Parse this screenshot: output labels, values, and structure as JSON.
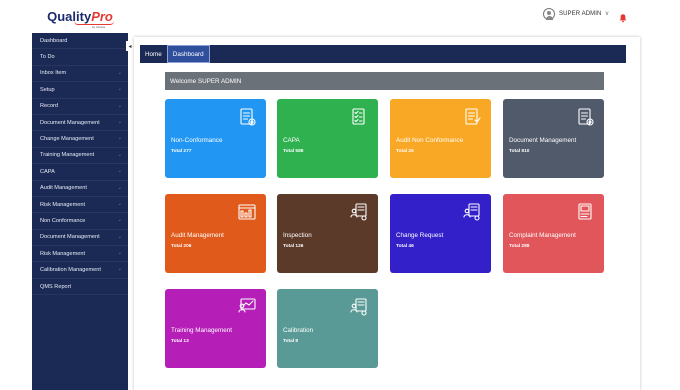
{
  "brand": {
    "name_main": "Quality",
    "name_accent": "Pro",
    "tagline": "by Vindus"
  },
  "header": {
    "user_name": "SUPER ADMIN",
    "caret": "v"
  },
  "sidebar": {
    "items": [
      {
        "label": "Dashboard",
        "chev": false
      },
      {
        "label": "To Do",
        "chev": false
      },
      {
        "label": "Inbox Item",
        "chev": true
      },
      {
        "label": "Setup",
        "chev": true
      },
      {
        "label": "Record",
        "chev": true
      },
      {
        "label": "Document Management",
        "chev": true
      },
      {
        "label": "Change Management",
        "chev": true
      },
      {
        "label": "Training Management",
        "chev": true
      },
      {
        "label": "CAPA",
        "chev": true
      },
      {
        "label": "Audit Management",
        "chev": true
      },
      {
        "label": "Risk Management",
        "chev": true
      },
      {
        "label": "Non Conformance",
        "chev": true
      },
      {
        "label": "Document Management",
        "chev": true
      },
      {
        "label": "Risk Management",
        "chev": true
      },
      {
        "label": "Calibration Management",
        "chev": true
      },
      {
        "label": "QMS Report",
        "chev": false
      }
    ]
  },
  "tabs": [
    {
      "label": "Home"
    },
    {
      "label": "Dashboard"
    }
  ],
  "welcome": {
    "text": "Welcome SUPER ADMIN"
  },
  "cards": [
    {
      "title": "Non-Conformance",
      "total": "Total 277",
      "color": "#2196f3",
      "icon": "clipboard-gear-icon"
    },
    {
      "title": "CAPA",
      "total": "Total 588",
      "color": "#2fb14f",
      "icon": "checklist-icon"
    },
    {
      "title": "Audit Non Conformance",
      "total": "Total 26",
      "color": "#f9a825",
      "icon": "document-audit-icon"
    },
    {
      "title": "Document Management",
      "total": "Total 810",
      "color": "#505a6b",
      "icon": "document-settings-icon"
    },
    {
      "title": "Audit Management",
      "total": "Total 206",
      "color": "#e05a1b",
      "icon": "audit-report-icon"
    },
    {
      "title": "Inspection",
      "total": "Total 126",
      "color": "#5c3a2a",
      "icon": "inspection-icon"
    },
    {
      "title": "Change Request",
      "total": "Total 46",
      "color": "#3320c9",
      "icon": "change-request-icon"
    },
    {
      "title": "Complaint Management",
      "total": "Total 288",
      "color": "#e0565a",
      "icon": "complaint-icon"
    },
    {
      "title": "Training Management",
      "total": "Total 13",
      "color": "#b51fb8",
      "icon": "training-icon"
    },
    {
      "title": "Calibration",
      "total": "Total 8",
      "color": "#5a9a96",
      "icon": "calibration-icon"
    }
  ]
}
